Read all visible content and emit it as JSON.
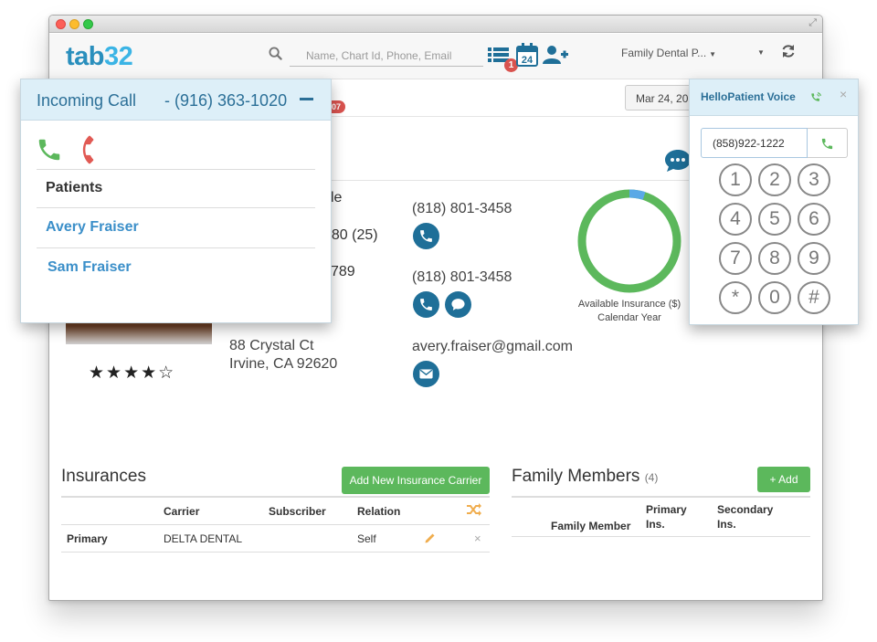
{
  "topbar": {
    "logo_text": "tab",
    "logo_num": "32",
    "search_placeholder": "Name, Chart Id, Phone, Email",
    "list_badge": "1",
    "calendar_day": "24",
    "practice_label": "Family Dental P..."
  },
  "subbar": {
    "date": "Mar 24, 201",
    "notif_badge": "07"
  },
  "patient": {
    "frag_name": "le",
    "frag_dob": "980 (25)",
    "frag_id": "789",
    "address_line1": "88 Crystal Ct",
    "address_line2": "Irvine, CA 92620",
    "phone1": "(818) 801-3458",
    "phone2": "(818) 801-3458",
    "email": "avery.fraiser@gmail.com",
    "rating_stars": 4,
    "rating_max": 5
  },
  "insurance_chart": {
    "label_line1": "Available Insurance ($)",
    "label_line2": "Calendar Year",
    "used_fraction": 0.05,
    "colors": {
      "available": "#5cb85c",
      "used": "#5aa9e6"
    }
  },
  "insurances": {
    "title": "Insurances",
    "add_button": "Add New Insurance Carrier",
    "headers": [
      "",
      "Carrier",
      "Subscriber",
      "Relation"
    ],
    "rows": [
      {
        "type": "Primary",
        "carrier": "DELTA DENTAL",
        "subscriber": "",
        "relation": "Self"
      }
    ]
  },
  "family": {
    "title": "Family Members",
    "count": "(4)",
    "add_button": "Add",
    "headers": {
      "member": "Family Member",
      "primary1": "Primary",
      "primary2": "Ins.",
      "secondary1": "Secondary",
      "secondary2": "Ins."
    }
  },
  "incoming_call": {
    "title": "Incoming Call",
    "number": "- (916) 363-1020",
    "patients_header": "Patients",
    "patients": [
      "Avery Fraiser",
      "Sam Fraiser"
    ]
  },
  "dialer": {
    "title": "HelloPatient Voice",
    "close": "×",
    "number_value": "(858)922-1222",
    "keys": [
      "1",
      "2",
      "3",
      "4",
      "5",
      "6",
      "7",
      "8",
      "9",
      "*",
      "0",
      "#"
    ]
  },
  "colors": {
    "brand_blue": "#2a8fbd",
    "call_green": "#5cb85c",
    "hangup_red": "#e15a54",
    "link_blue": "#3b8fc9",
    "dark_blue": "#1f6f98"
  }
}
